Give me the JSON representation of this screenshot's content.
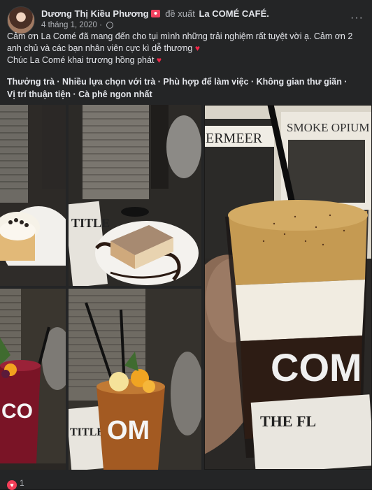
{
  "header": {
    "author": "Dương Thị Kiều Phương",
    "action": "đề xuất",
    "page": "La COMÉ CAFÉ.",
    "date": "4 tháng 1, 2020",
    "dot": "·",
    "more": "···"
  },
  "post": {
    "line1": "Cảm ơn La Comé đã mang đến cho tụi mình  những trải nghiệm rất tuyệt vời ạ. Cảm ơn 2 anh chủ và các bạn nhân viên cực kì dễ thương",
    "line2": "Chúc La Comé khai trương hồng phát",
    "heart": "♥",
    "tags_line1": "Thưởng trà · Nhiều lựa chọn với trà · Phù hợp để làm việc · Không gian thư giãn ·",
    "tags_line2": "Vị trí thuận tiện · Cà phê ngon nhất"
  },
  "photos": {
    "p1_cup_text": "",
    "p2_book_text": "TITLE",
    "p3_cup_text": "CO",
    "p4_cup_text": "OM",
    "p4_book_text": "TITLE",
    "p5_poster1": "ERMEER",
    "p5_poster2": "SMOKE OPIUM",
    "p5_cup_text": "COM",
    "p5_book_text": "THE FL"
  },
  "reactions": {
    "icon": "♥",
    "count": "1"
  },
  "colors": {
    "background": "#242526",
    "text": "#e4e6eb",
    "secondary": "#b0b3b8",
    "heart": "#f33e58"
  }
}
